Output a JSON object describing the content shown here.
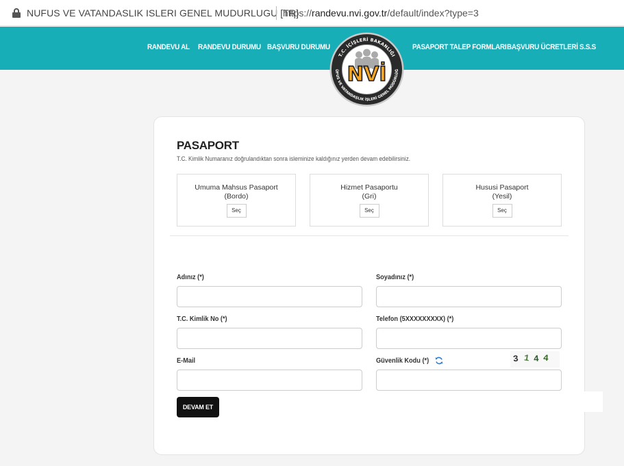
{
  "browser": {
    "site_title": "NUFUS VE VATANDASLIK ISLERI GENEL MUDURLUGU [TR]",
    "url_prefix": "https://",
    "url_host": "randevu.nvi.gov.tr",
    "url_path": "/default/index?type=3"
  },
  "nav": {
    "items": [
      "RANDEVU AL",
      "RANDEVU DURUMU",
      "BAŞVURU DURUMU",
      "PASAPORT TALEP FORMLARI",
      "BAŞVURU ÜCRETLERİ",
      "S.S.S"
    ],
    "logo": {
      "text": "NVİ",
      "ring_top": "T.C. İÇİŞLERİ BAKANLIĞI",
      "ring_bottom": "NÜFUS VE VATANDAŞLIK İŞLERİ GENEL MÜDÜRLÜĞÜ"
    },
    "bar_color": "#17aeb7"
  },
  "form": {
    "title": "PASAPORT",
    "subtitle": "T.C. Kimlik Numaranız doğrulandıktan sonra isleminize kaldığınız yerden devam edebilirsiniz.",
    "passport_types": [
      {
        "name": "Umuma Mahsus Pasaport",
        "color": "(Bordo)",
        "button": "Seç"
      },
      {
        "name": "Hizmet Pasaportu",
        "color": "(Gri)",
        "button": "Seç"
      },
      {
        "name": "Hususi Pasaport",
        "color": "(Yesil)",
        "button": "Seç"
      }
    ],
    "fields": {
      "first_name": {
        "label": "Adınız (*)",
        "value": ""
      },
      "last_name": {
        "label": "Soyadınız (*)",
        "value": ""
      },
      "tc_no": {
        "label": "T.C. Kimlik No (*)",
        "value": ""
      },
      "phone": {
        "label": "Telefon (5XXXXXXXXX) (*)",
        "value": ""
      },
      "email": {
        "label": "E-Mail",
        "value": ""
      },
      "captcha": {
        "label": "Güvenlik Kodu (*)",
        "value": "",
        "image_text": "3144",
        "refresh_icon": "refresh-icon"
      }
    },
    "submit_label": "DEVAM ET"
  }
}
